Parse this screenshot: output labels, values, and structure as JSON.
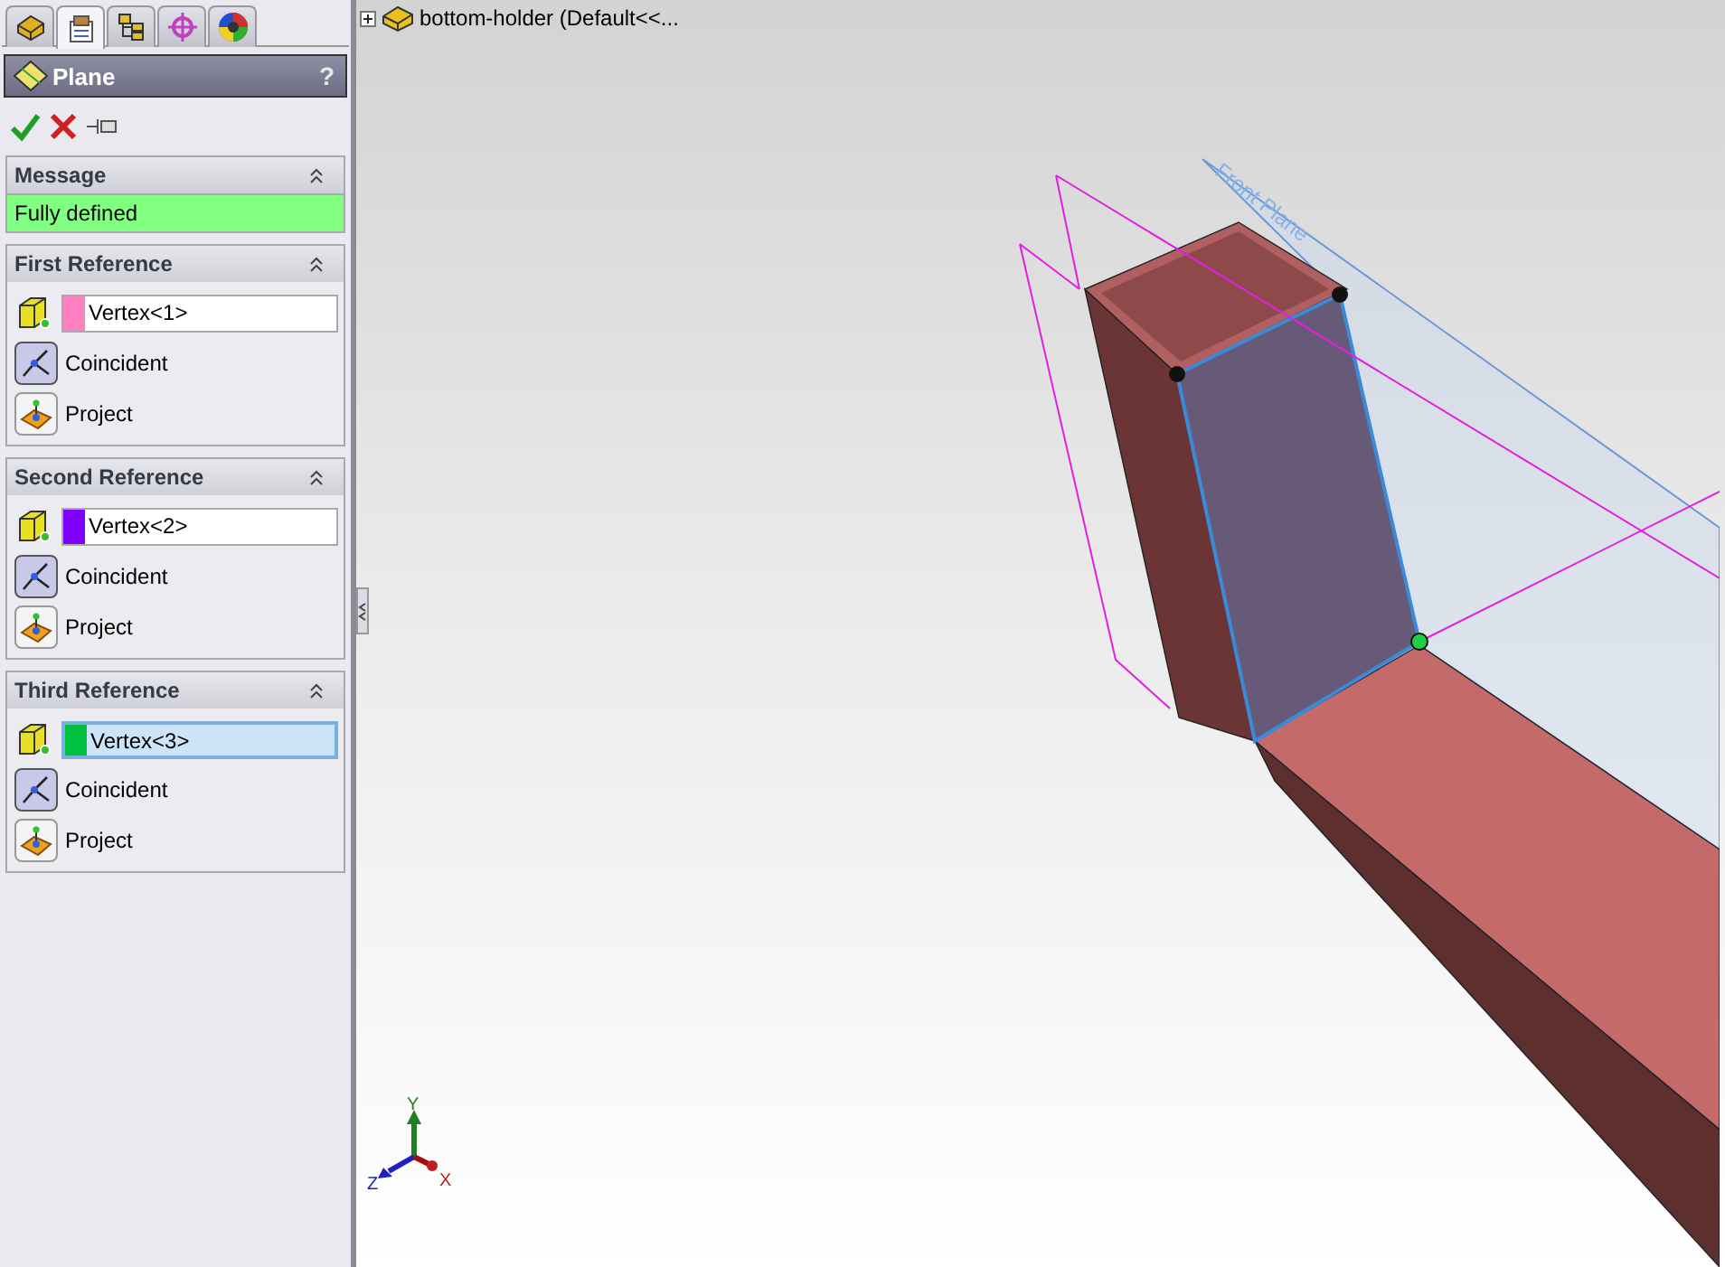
{
  "tabs": [
    {
      "kind": "feature",
      "selected": false
    },
    {
      "kind": "property",
      "selected": true
    },
    {
      "kind": "config",
      "selected": false
    },
    {
      "kind": "dimxpert",
      "selected": false
    },
    {
      "kind": "display",
      "selected": false
    }
  ],
  "property_manager": {
    "title": "Plane",
    "help": "?"
  },
  "message": {
    "title": "Message",
    "text": "Fully defined",
    "expanded": true
  },
  "references": [
    {
      "title": "First Reference",
      "expanded": true,
      "value": "Vertex<1>",
      "color": "#ff80c0",
      "selected": false,
      "options": [
        {
          "kind": "coincident",
          "label": "Coincident",
          "selected": true
        },
        {
          "kind": "project",
          "label": "Project",
          "selected": false
        }
      ]
    },
    {
      "title": "Second Reference",
      "expanded": true,
      "value": "Vertex<2>",
      "color": "#8000ff",
      "selected": false,
      "options": [
        {
          "kind": "coincident",
          "label": "Coincident",
          "selected": true
        },
        {
          "kind": "project",
          "label": "Project",
          "selected": false
        }
      ]
    },
    {
      "title": "Third Reference",
      "expanded": true,
      "value": "Vertex<3>",
      "color": "#00c040",
      "selected": true,
      "options": [
        {
          "kind": "coincident",
          "label": "Coincident",
          "selected": true
        },
        {
          "kind": "project",
          "label": "Project",
          "selected": false
        }
      ]
    }
  ],
  "tree": {
    "label": "bottom-holder  (Default<<...",
    "expanded": false
  },
  "viewport": {
    "plane_label": "Front Plane",
    "axes": {
      "x": "X",
      "y": "Y",
      "z": "Z"
    }
  }
}
